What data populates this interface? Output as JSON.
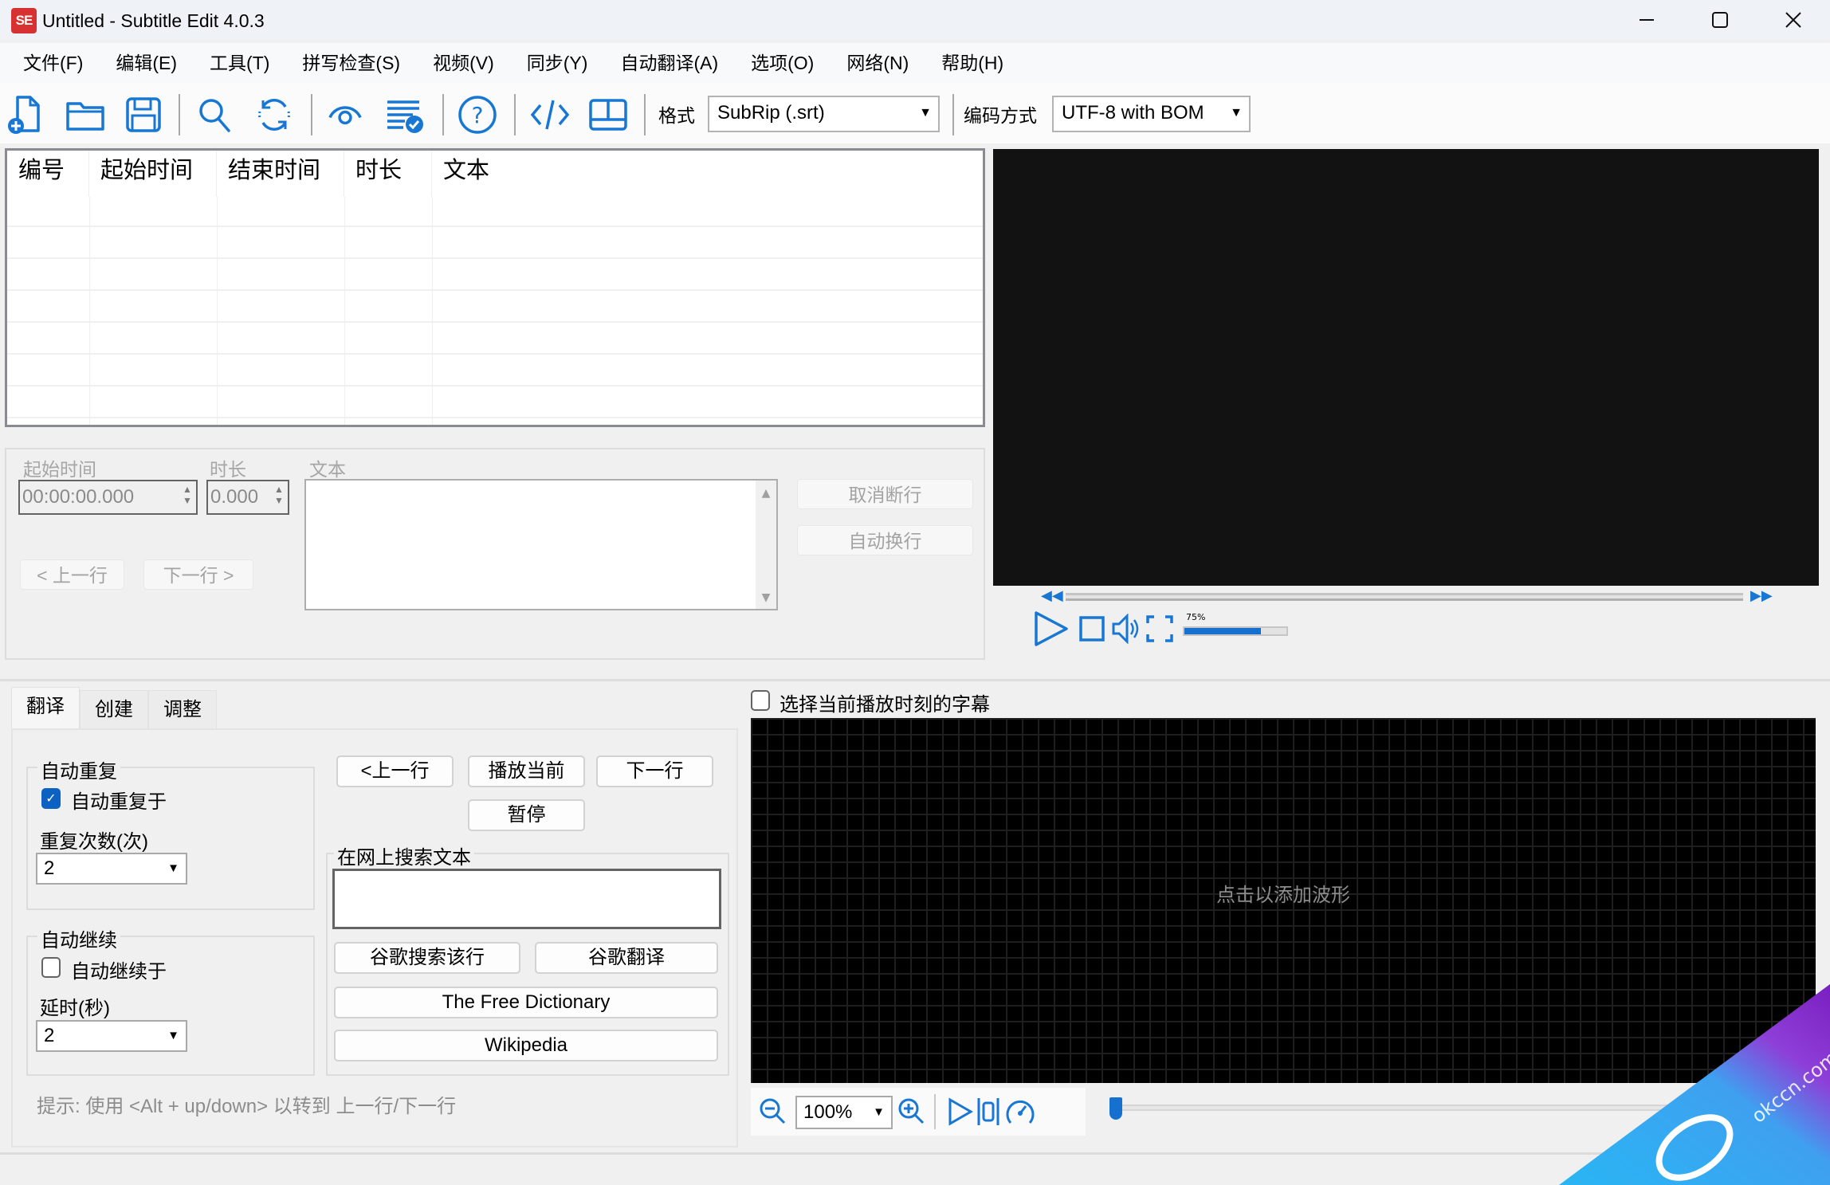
{
  "window": {
    "app_icon_text": "SE",
    "title": "Untitled - Subtitle Edit 4.0.3",
    "controls": [
      "minimize",
      "maximize",
      "close"
    ]
  },
  "menu": [
    "文件(F)",
    "编辑(E)",
    "工具(T)",
    "拼写检查(S)",
    "视频(V)",
    "同步(Y)",
    "自动翻译(A)",
    "选项(O)",
    "网络(N)",
    "帮助(H)"
  ],
  "toolbar": {
    "icons": [
      "new-file-icon",
      "open-folder-icon",
      "save-icon",
      "find-icon",
      "replace-icon",
      "visual-sync-icon",
      "spell-check-icon",
      "help-icon",
      "source-view-icon",
      "layout-icon"
    ],
    "format_label": "格式",
    "format_value": "SubRip (.srt)",
    "encoding_label": "编码方式",
    "encoding_value": "UTF-8 with BOM"
  },
  "subtitle_list": {
    "columns": [
      "编号",
      "起始时间",
      "结束时间",
      "时长",
      "文本"
    ],
    "rows": []
  },
  "edit_panel": {
    "start_time_label": "起始时间",
    "start_time_value": "00:00:00.000",
    "duration_label": "时长",
    "duration_value": "0.000",
    "text_label": "文本",
    "text_value": "",
    "prev_button": "< 上一行",
    "next_button": "下一行 >",
    "unbreak_button": "取消断行",
    "auto_break_button": "自动换行"
  },
  "video_player": {
    "volume_percent": 75,
    "volume_label": "75%",
    "position_fraction": 0
  },
  "tabs": {
    "items": [
      "翻译",
      "创建",
      "调整"
    ],
    "active": "翻译"
  },
  "translate_tab": {
    "auto_repeat": {
      "group_title": "自动重复",
      "checkbox_label": "自动重复于",
      "checked": true,
      "count_label": "重复次数(次)",
      "count_value": "2"
    },
    "auto_continue": {
      "group_title": "自动继续",
      "checkbox_label": "自动继续于",
      "checked": false,
      "delay_label": "延时(秒)",
      "delay_value": "2"
    },
    "buttons": {
      "prev": "<上一行",
      "play_current": "播放当前",
      "next": "下一行",
      "pause": "暂停"
    },
    "search": {
      "group_title": "在网上搜索文本",
      "input_value": "",
      "google_search_line": "谷歌搜索该行",
      "google_translate": "谷歌翻译",
      "free_dictionary": "The Free Dictionary",
      "wikipedia": "Wikipedia"
    },
    "hint": "提示: 使用 <Alt + up/down> 以转到 上一行/下一行"
  },
  "waveform": {
    "select_current_label": "选择当前播放时刻的字幕",
    "select_current_checked": false,
    "click_hint": "点击以添加波形",
    "zoom_value": "100%",
    "position_fraction": 0
  },
  "watermark": {
    "text": "okccn.com"
  }
}
